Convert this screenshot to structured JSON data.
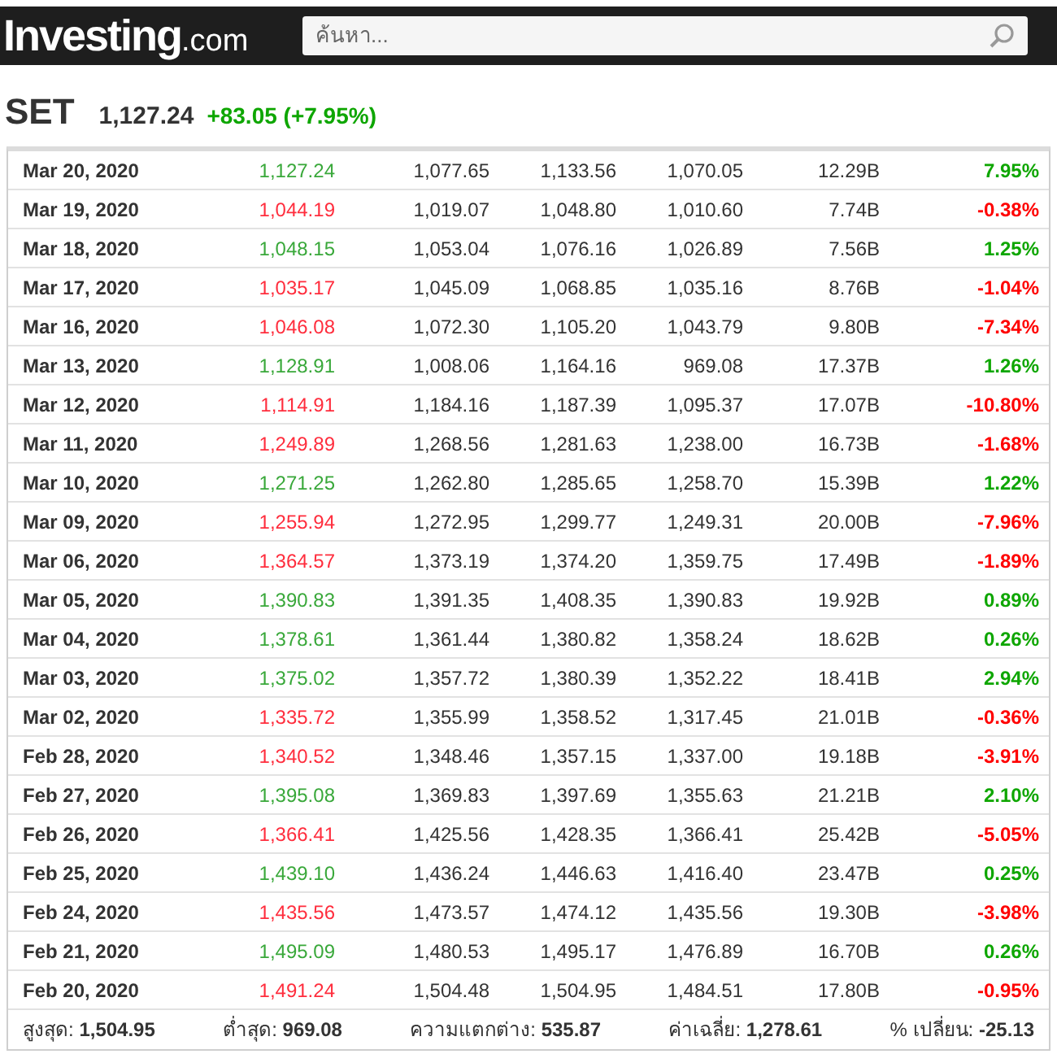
{
  "header": {
    "logo": "Investing",
    "logo_suffix": ".com",
    "search": {
      "placeholder": "ค้นหา..."
    }
  },
  "instrument": {
    "symbol": "SET",
    "price": "1,127.24",
    "change": "+83.05 (+7.95%)",
    "up": true
  },
  "table": {
    "rows": [
      {
        "date": "Mar 20, 2020",
        "price": "1,127.24",
        "open": "1,077.65",
        "high": "1,133.56",
        "low": "1,070.05",
        "volume": "12.29B",
        "change": "7.95%",
        "up": true
      },
      {
        "date": "Mar 19, 2020",
        "price": "1,044.19",
        "open": "1,019.07",
        "high": "1,048.80",
        "low": "1,010.60",
        "volume": "7.74B",
        "change": "-0.38%",
        "up": false
      },
      {
        "date": "Mar 18, 2020",
        "price": "1,048.15",
        "open": "1,053.04",
        "high": "1,076.16",
        "low": "1,026.89",
        "volume": "7.56B",
        "change": "1.25%",
        "up": true
      },
      {
        "date": "Mar 17, 2020",
        "price": "1,035.17",
        "open": "1,045.09",
        "high": "1,068.85",
        "low": "1,035.16",
        "volume": "8.76B",
        "change": "-1.04%",
        "up": false
      },
      {
        "date": "Mar 16, 2020",
        "price": "1,046.08",
        "open": "1,072.30",
        "high": "1,105.20",
        "low": "1,043.79",
        "volume": "9.80B",
        "change": "-7.34%",
        "up": false
      },
      {
        "date": "Mar 13, 2020",
        "price": "1,128.91",
        "open": "1,008.06",
        "high": "1,164.16",
        "low": "969.08",
        "volume": "17.37B",
        "change": "1.26%",
        "up": true
      },
      {
        "date": "Mar 12, 2020",
        "price": "1,114.91",
        "open": "1,184.16",
        "high": "1,187.39",
        "low": "1,095.37",
        "volume": "17.07B",
        "change": "-10.80%",
        "up": false
      },
      {
        "date": "Mar 11, 2020",
        "price": "1,249.89",
        "open": "1,268.56",
        "high": "1,281.63",
        "low": "1,238.00",
        "volume": "16.73B",
        "change": "-1.68%",
        "up": false
      },
      {
        "date": "Mar 10, 2020",
        "price": "1,271.25",
        "open": "1,262.80",
        "high": "1,285.65",
        "low": "1,258.70",
        "volume": "15.39B",
        "change": "1.22%",
        "up": true
      },
      {
        "date": "Mar 09, 2020",
        "price": "1,255.94",
        "open": "1,272.95",
        "high": "1,299.77",
        "low": "1,249.31",
        "volume": "20.00B",
        "change": "-7.96%",
        "up": false
      },
      {
        "date": "Mar 06, 2020",
        "price": "1,364.57",
        "open": "1,373.19",
        "high": "1,374.20",
        "low": "1,359.75",
        "volume": "17.49B",
        "change": "-1.89%",
        "up": false
      },
      {
        "date": "Mar 05, 2020",
        "price": "1,390.83",
        "open": "1,391.35",
        "high": "1,408.35",
        "low": "1,390.83",
        "volume": "19.92B",
        "change": "0.89%",
        "up": true
      },
      {
        "date": "Mar 04, 2020",
        "price": "1,378.61",
        "open": "1,361.44",
        "high": "1,380.82",
        "low": "1,358.24",
        "volume": "18.62B",
        "change": "0.26%",
        "up": true
      },
      {
        "date": "Mar 03, 2020",
        "price": "1,375.02",
        "open": "1,357.72",
        "high": "1,380.39",
        "low": "1,352.22",
        "volume": "18.41B",
        "change": "2.94%",
        "up": true
      },
      {
        "date": "Mar 02, 2020",
        "price": "1,335.72",
        "open": "1,355.99",
        "high": "1,358.52",
        "low": "1,317.45",
        "volume": "21.01B",
        "change": "-0.36%",
        "up": false
      },
      {
        "date": "Feb 28, 2020",
        "price": "1,340.52",
        "open": "1,348.46",
        "high": "1,357.15",
        "low": "1,337.00",
        "volume": "19.18B",
        "change": "-3.91%",
        "up": false
      },
      {
        "date": "Feb 27, 2020",
        "price": "1,395.08",
        "open": "1,369.83",
        "high": "1,397.69",
        "low": "1,355.63",
        "volume": "21.21B",
        "change": "2.10%",
        "up": true
      },
      {
        "date": "Feb 26, 2020",
        "price": "1,366.41",
        "open": "1,425.56",
        "high": "1,428.35",
        "low": "1,366.41",
        "volume": "25.42B",
        "change": "-5.05%",
        "up": false
      },
      {
        "date": "Feb 25, 2020",
        "price": "1,439.10",
        "open": "1,436.24",
        "high": "1,446.63",
        "low": "1,416.40",
        "volume": "23.47B",
        "change": "0.25%",
        "up": true
      },
      {
        "date": "Feb 24, 2020",
        "price": "1,435.56",
        "open": "1,473.57",
        "high": "1,474.12",
        "low": "1,435.56",
        "volume": "19.30B",
        "change": "-3.98%",
        "up": false
      },
      {
        "date": "Feb 21, 2020",
        "price": "1,495.09",
        "open": "1,480.53",
        "high": "1,495.17",
        "low": "1,476.89",
        "volume": "16.70B",
        "change": "0.26%",
        "up": true
      },
      {
        "date": "Feb 20, 2020",
        "price": "1,491.24",
        "open": "1,504.48",
        "high": "1,504.95",
        "low": "1,484.51",
        "volume": "17.80B",
        "change": "-0.95%",
        "up": false
      }
    ]
  },
  "summary": [
    {
      "label": "สูงสุด:",
      "value": "1,504.95"
    },
    {
      "label": "ต่ำสุด:",
      "value": "969.08"
    },
    {
      "label": "ความแตกต่าง:",
      "value": "535.87"
    },
    {
      "label": "ค่าเฉลี่ย:",
      "value": "1,278.61"
    },
    {
      "label": "% เปลี่ยน:",
      "value": "-25.13"
    }
  ]
}
